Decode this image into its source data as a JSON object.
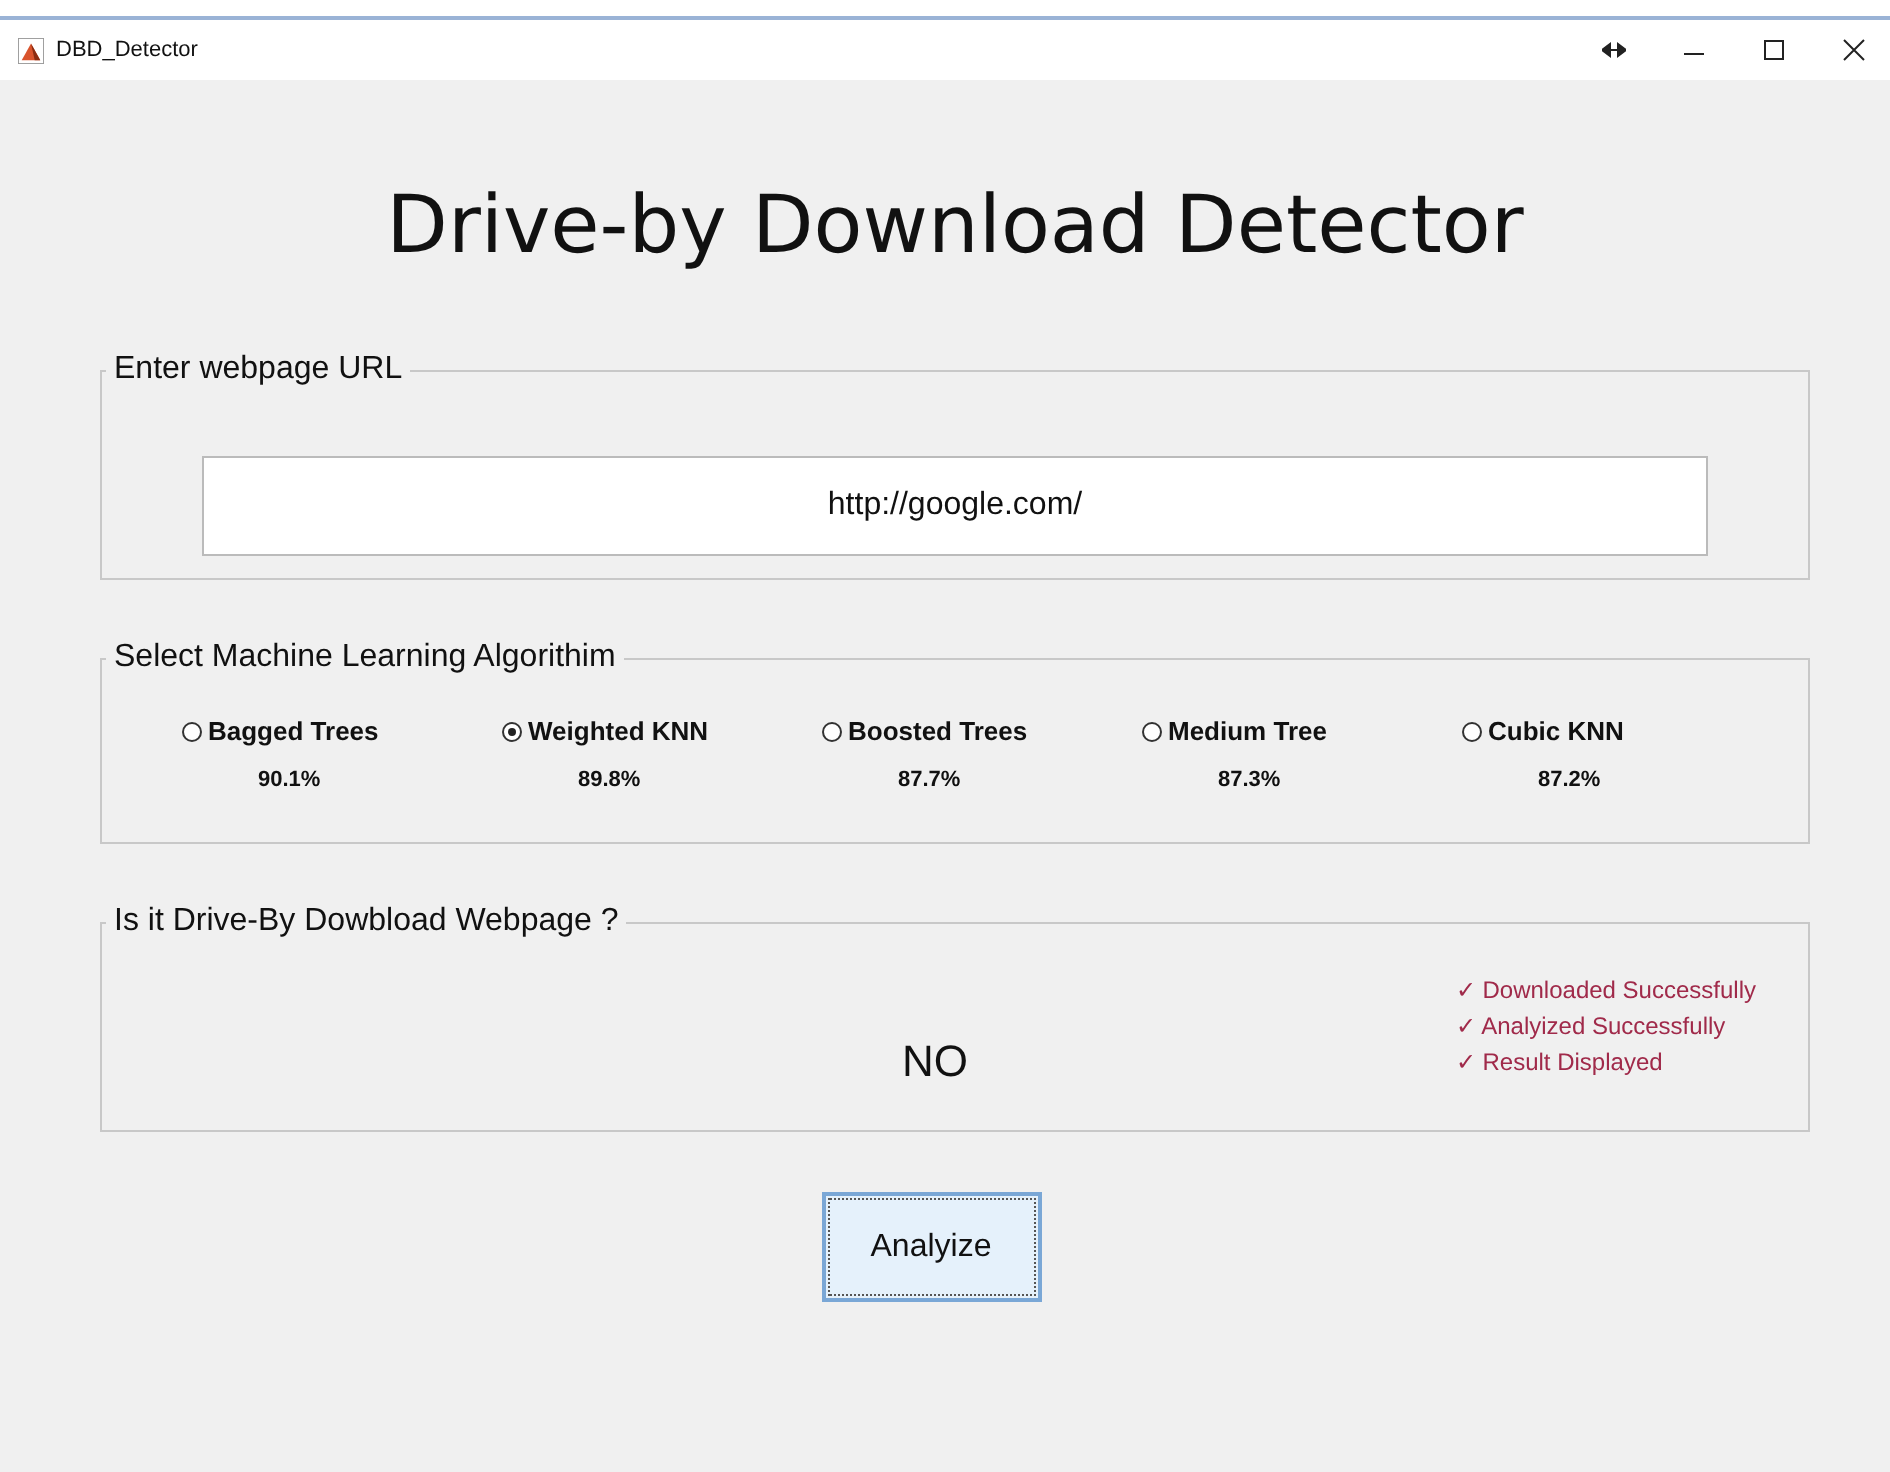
{
  "window": {
    "title": "DBD_Detector"
  },
  "heading": "Drive-by Download Detector",
  "url_panel": {
    "legend": "Enter webpage URL",
    "value": "http://google.com/"
  },
  "algorithm_panel": {
    "legend": "Select Machine Learning Algorithim",
    "options": [
      {
        "label": "Bagged Trees",
        "accuracy": "90.1%",
        "selected": false
      },
      {
        "label": "Weighted KNN",
        "accuracy": "89.8%",
        "selected": true
      },
      {
        "label": "Boosted Trees",
        "accuracy": "87.7%",
        "selected": false
      },
      {
        "label": "Medium Tree",
        "accuracy": "87.3%",
        "selected": false
      },
      {
        "label": "Cubic KNN",
        "accuracy": "87.2%",
        "selected": false
      }
    ]
  },
  "result_panel": {
    "legend": "Is it Drive-By Dowbload Webpage ?",
    "result": "NO",
    "status": [
      "✓ Downloaded Successfully",
      "✓ Analyized Successfully",
      "✓ Result Displayed"
    ]
  },
  "button": "Analyize"
}
